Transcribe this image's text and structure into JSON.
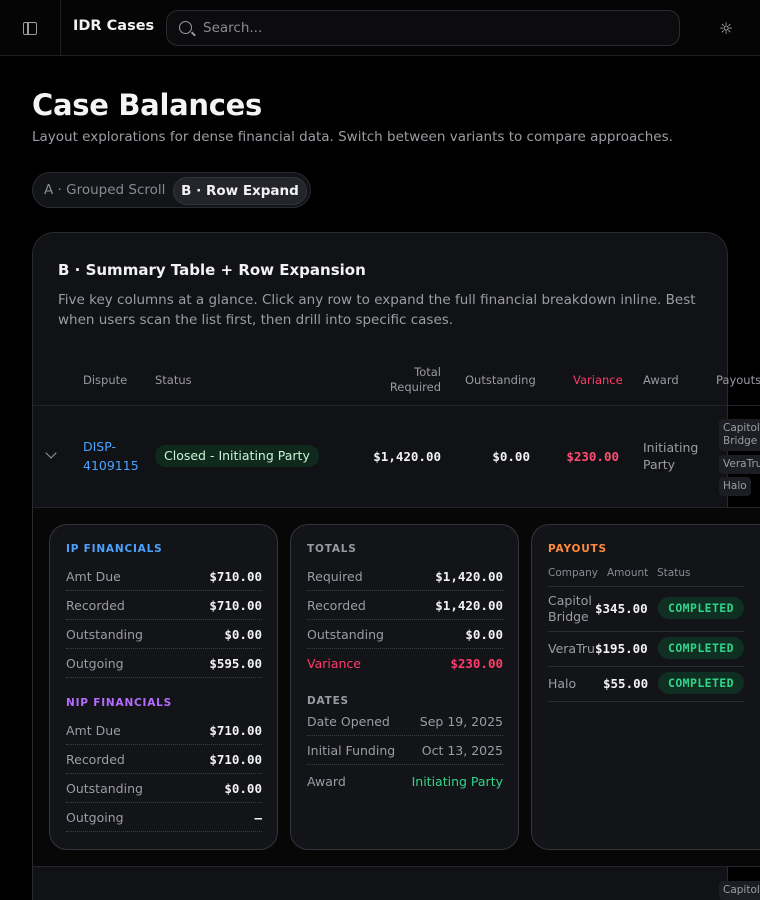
{
  "header": {
    "app_title": "IDR Cases",
    "search_placeholder": "Search...",
    "sidebar_icon": "sidebar-icon",
    "theme_icon": "sun-icon"
  },
  "page": {
    "title": "Case Balances",
    "subtitle": "Layout explorations for dense financial data. Switch between variants to compare approaches.",
    "variants": [
      {
        "label": "A · Grouped Scroll",
        "selected": false
      },
      {
        "label": "B · Row Expand",
        "selected": true
      }
    ]
  },
  "card": {
    "title": "B · Summary Table + Row Expansion",
    "description": "Five key columns at a glance. Click any row to expand the full financial breakdown inline. Best when users scan the list first, then drill into specific cases."
  },
  "table": {
    "columns": {
      "dispute": "Dispute",
      "status": "Status",
      "total_required": "Total Required",
      "outstanding": "Outstanding",
      "variance": "Variance",
      "award": "Award",
      "payouts": "Payouts"
    },
    "rows": [
      {
        "dispute": "DISP-4109115",
        "status": "Closed - Initiating Party",
        "total_required": "$1,420.00",
        "outstanding": "$0.00",
        "variance": "$230.00",
        "award": "Initiating Party",
        "payouts": [
          "Capitol Bridge",
          "VeraTru",
          "Halo"
        ]
      }
    ],
    "next_row_payout_partial": "Capitol"
  },
  "expansion": {
    "ip": {
      "heading": "IP FINANCIALS",
      "items": [
        {
          "label": "Amt Due",
          "value": "$710.00"
        },
        {
          "label": "Recorded",
          "value": "$710.00"
        },
        {
          "label": "Outstanding",
          "value": "$0.00"
        },
        {
          "label": "Outgoing",
          "value": "$595.00"
        }
      ]
    },
    "nip": {
      "heading": "NIP FINANCIALS",
      "items": [
        {
          "label": "Amt Due",
          "value": "$710.00"
        },
        {
          "label": "Recorded",
          "value": "$710.00"
        },
        {
          "label": "Outstanding",
          "value": "$0.00"
        },
        {
          "label": "Outgoing",
          "value": "–"
        }
      ]
    },
    "totals": {
      "heading": "TOTALS",
      "items": [
        {
          "label": "Required",
          "value": "$1,420.00"
        },
        {
          "label": "Recorded",
          "value": "$1,420.00"
        },
        {
          "label": "Outstanding",
          "value": "$0.00"
        },
        {
          "label": "Variance",
          "value": "$230.00"
        }
      ]
    },
    "dates": {
      "heading": "DATES",
      "items": [
        {
          "label": "Date Opened",
          "value": "Sep 19, 2025"
        },
        {
          "label": "Initial Funding",
          "value": "Oct 13, 2025"
        },
        {
          "label": "Award",
          "value": "Initiating Party"
        }
      ]
    },
    "payouts": {
      "heading": "PAYOUTS",
      "columns": {
        "company": "Company",
        "amount": "Amount",
        "status": "Status"
      },
      "items": [
        {
          "company": "Capitol Bridge",
          "amount": "$345.00",
          "status": "COMPLETED"
        },
        {
          "company": "VeraTru",
          "amount": "$195.00",
          "status": "COMPLETED"
        },
        {
          "company": "Halo",
          "amount": "$55.00",
          "status": "COMPLETED"
        }
      ]
    }
  },
  "colors": {
    "accent_blue": "#4aa3ff",
    "variance_red": "#ff3b6b",
    "success_green": "#2fd68a",
    "payouts_orange": "#ff8a3d",
    "nip_purple": "#b46cff"
  }
}
